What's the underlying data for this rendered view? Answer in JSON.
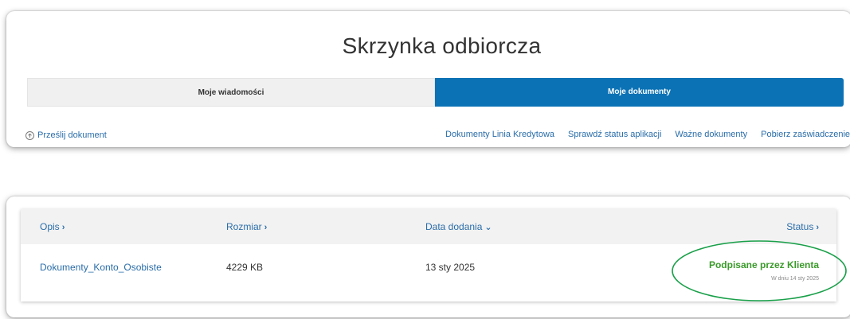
{
  "page": {
    "title": "Skrzynka odbiorcza"
  },
  "tabs": [
    {
      "label": "Moje wiadomości",
      "active": false
    },
    {
      "label": "Moje dokumenty",
      "active": true
    }
  ],
  "upload": {
    "label": "Prześlij dokument",
    "icon": "upload-circle-icon"
  },
  "links": [
    {
      "label": "Dokumenty Linia Kredytowa"
    },
    {
      "label": "Sprawdź status aplikacji"
    },
    {
      "label": "Ważne dokumenty"
    },
    {
      "label": "Pobierz zaświadczenie"
    }
  ],
  "table": {
    "columns": [
      {
        "label": "Opis",
        "arrow": "›",
        "icon": "chevron-right-icon"
      },
      {
        "label": "Rozmiar",
        "arrow": "›",
        "icon": "chevron-right-icon"
      },
      {
        "label": "Data dodania",
        "arrow": "⌄",
        "icon": "chevron-down-icon"
      },
      {
        "label": "Status",
        "arrow": "›",
        "icon": "chevron-right-icon"
      }
    ],
    "rows": [
      {
        "name": "Dokumenty_Konto_Osobiste",
        "size": "4229 KB",
        "date": "13 sty 2025",
        "status": "Podpisane przez Klienta",
        "status_date": "W dniu 14 sty 2025"
      }
    ]
  },
  "colors": {
    "accent": "#0b72b5",
    "link": "#2a6da9",
    "status_green": "#3a9a2a",
    "highlight_ellipse": "#1aa04a"
  }
}
